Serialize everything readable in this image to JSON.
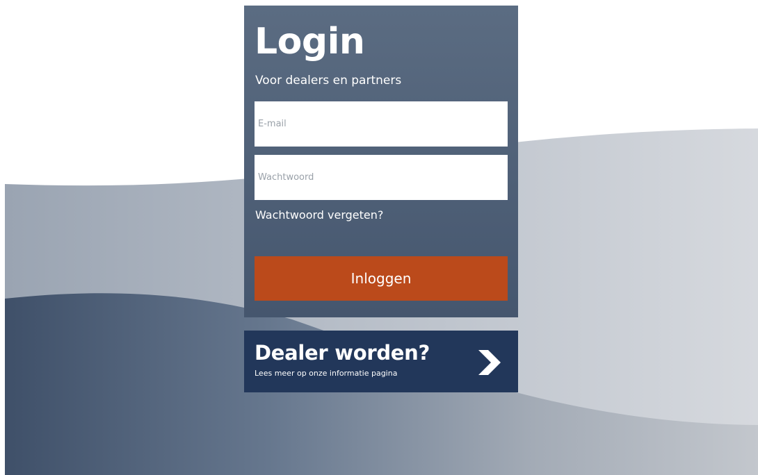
{
  "login": {
    "title": "Login",
    "subtitle": "Voor dealers en partners",
    "email_placeholder": "E-mail",
    "password_placeholder": "Wachtwoord",
    "forgot_password": "Wachtwoord vergeten?",
    "submit_label": "Inloggen"
  },
  "dealer_banner": {
    "title": "Dealer worden?",
    "subtitle": "Lees meer op onze informatie pagina",
    "icon": "chevron-right-icon"
  },
  "colors": {
    "card_bg": "#52637a",
    "button_bg": "#bb4a1b",
    "banner_bg": "#22375a",
    "wave_dark": "#3f5069",
    "wave_light": "#d5d8dd"
  }
}
